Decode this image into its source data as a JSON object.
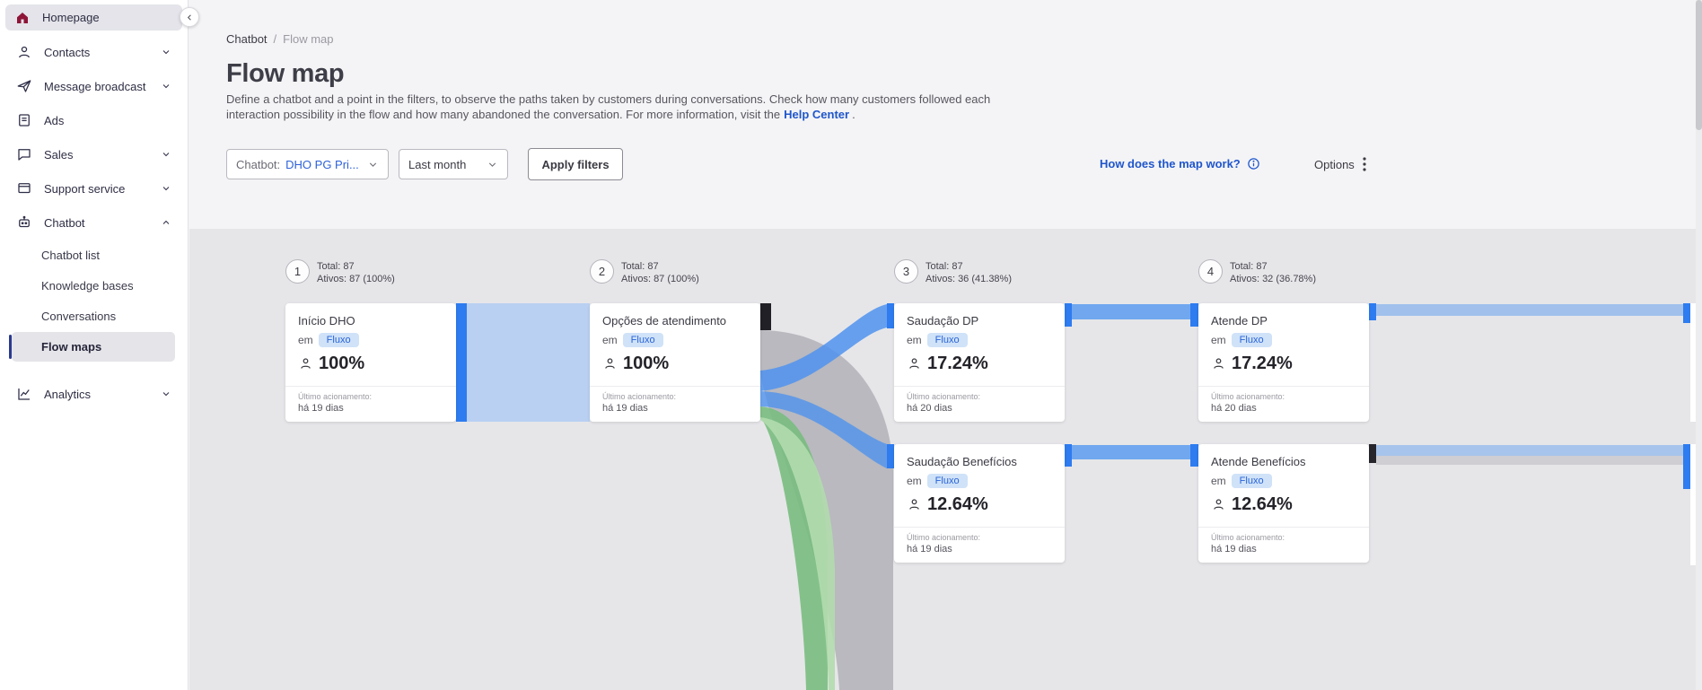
{
  "sidebar": {
    "items": [
      {
        "label": "Homepage"
      },
      {
        "label": "Contacts"
      },
      {
        "label": "Message broadcast"
      },
      {
        "label": "Ads"
      },
      {
        "label": "Sales"
      },
      {
        "label": "Support service"
      },
      {
        "label": "Chatbot"
      },
      {
        "label": "Analytics"
      }
    ],
    "chatbot_children": [
      {
        "label": "Chatbot list"
      },
      {
        "label": "Knowledge bases"
      },
      {
        "label": "Conversations"
      },
      {
        "label": "Flow maps"
      }
    ],
    "active_item": "Homepage",
    "active_subitem": "Flow maps"
  },
  "breadcrumb": {
    "parent": "Chatbot",
    "separator": "/",
    "current": "Flow map"
  },
  "header": {
    "title": "Flow map",
    "description": "Define a chatbot and a point in the filters, to observe the paths taken by customers during conversations. Check how many customers followed each interaction possibility in the flow and how many abandoned the conversation. For more information, visit the",
    "help_link": "Help Center",
    "description_suffix": "."
  },
  "filters": {
    "chatbot_label": "Chatbot:",
    "chatbot_value": "DHO PG Pri...",
    "period_value": "Last month",
    "apply_label": "Apply filters",
    "map_help_link": "How does the map work?",
    "options_label": "Options"
  },
  "flow": {
    "labels": {
      "em": "em",
      "badge": "Fluxo",
      "last_trigger": "Último acionamento:"
    },
    "columns": [
      {
        "number": "1",
        "total": "Total: 87",
        "active": "Ativos: 87 (100%)"
      },
      {
        "number": "2",
        "total": "Total: 87",
        "active": "Ativos: 87 (100%)"
      },
      {
        "number": "3",
        "total": "Total: 87",
        "active": "Ativos: 36 (41.38%)"
      },
      {
        "number": "4",
        "total": "Total: 87",
        "active": "Ativos: 32 (36.78%)"
      }
    ],
    "cards": [
      {
        "title": "Início DHO",
        "percent": "100%",
        "last": "há 19 dias"
      },
      {
        "title": "Opções de atendimento",
        "percent": "100%",
        "last": "há 19 dias"
      },
      {
        "title": "Saudação DP",
        "percent": "17.24%",
        "last": "há 20 dias"
      },
      {
        "title": "Saudação Benefícios",
        "percent": "12.64%",
        "last": "há 19 dias"
      },
      {
        "title": "Atende DP",
        "percent": "17.24%",
        "last": "há 20 dias"
      },
      {
        "title": "Atende Benefícios",
        "percent": "12.64%",
        "last": "há 19 dias"
      }
    ]
  },
  "colors": {
    "accent_blue": "#2d62d9",
    "node_blue": "#2e7cf0",
    "ribbon_blue_light": "#b9d0f2",
    "ribbon_gray": "#b4b4ba",
    "ribbon_green": "#79bd80",
    "badge_bg": "#cfe2f8",
    "sidebar_active_bar": "#2b3a8f",
    "home_icon": "#8e1538"
  }
}
